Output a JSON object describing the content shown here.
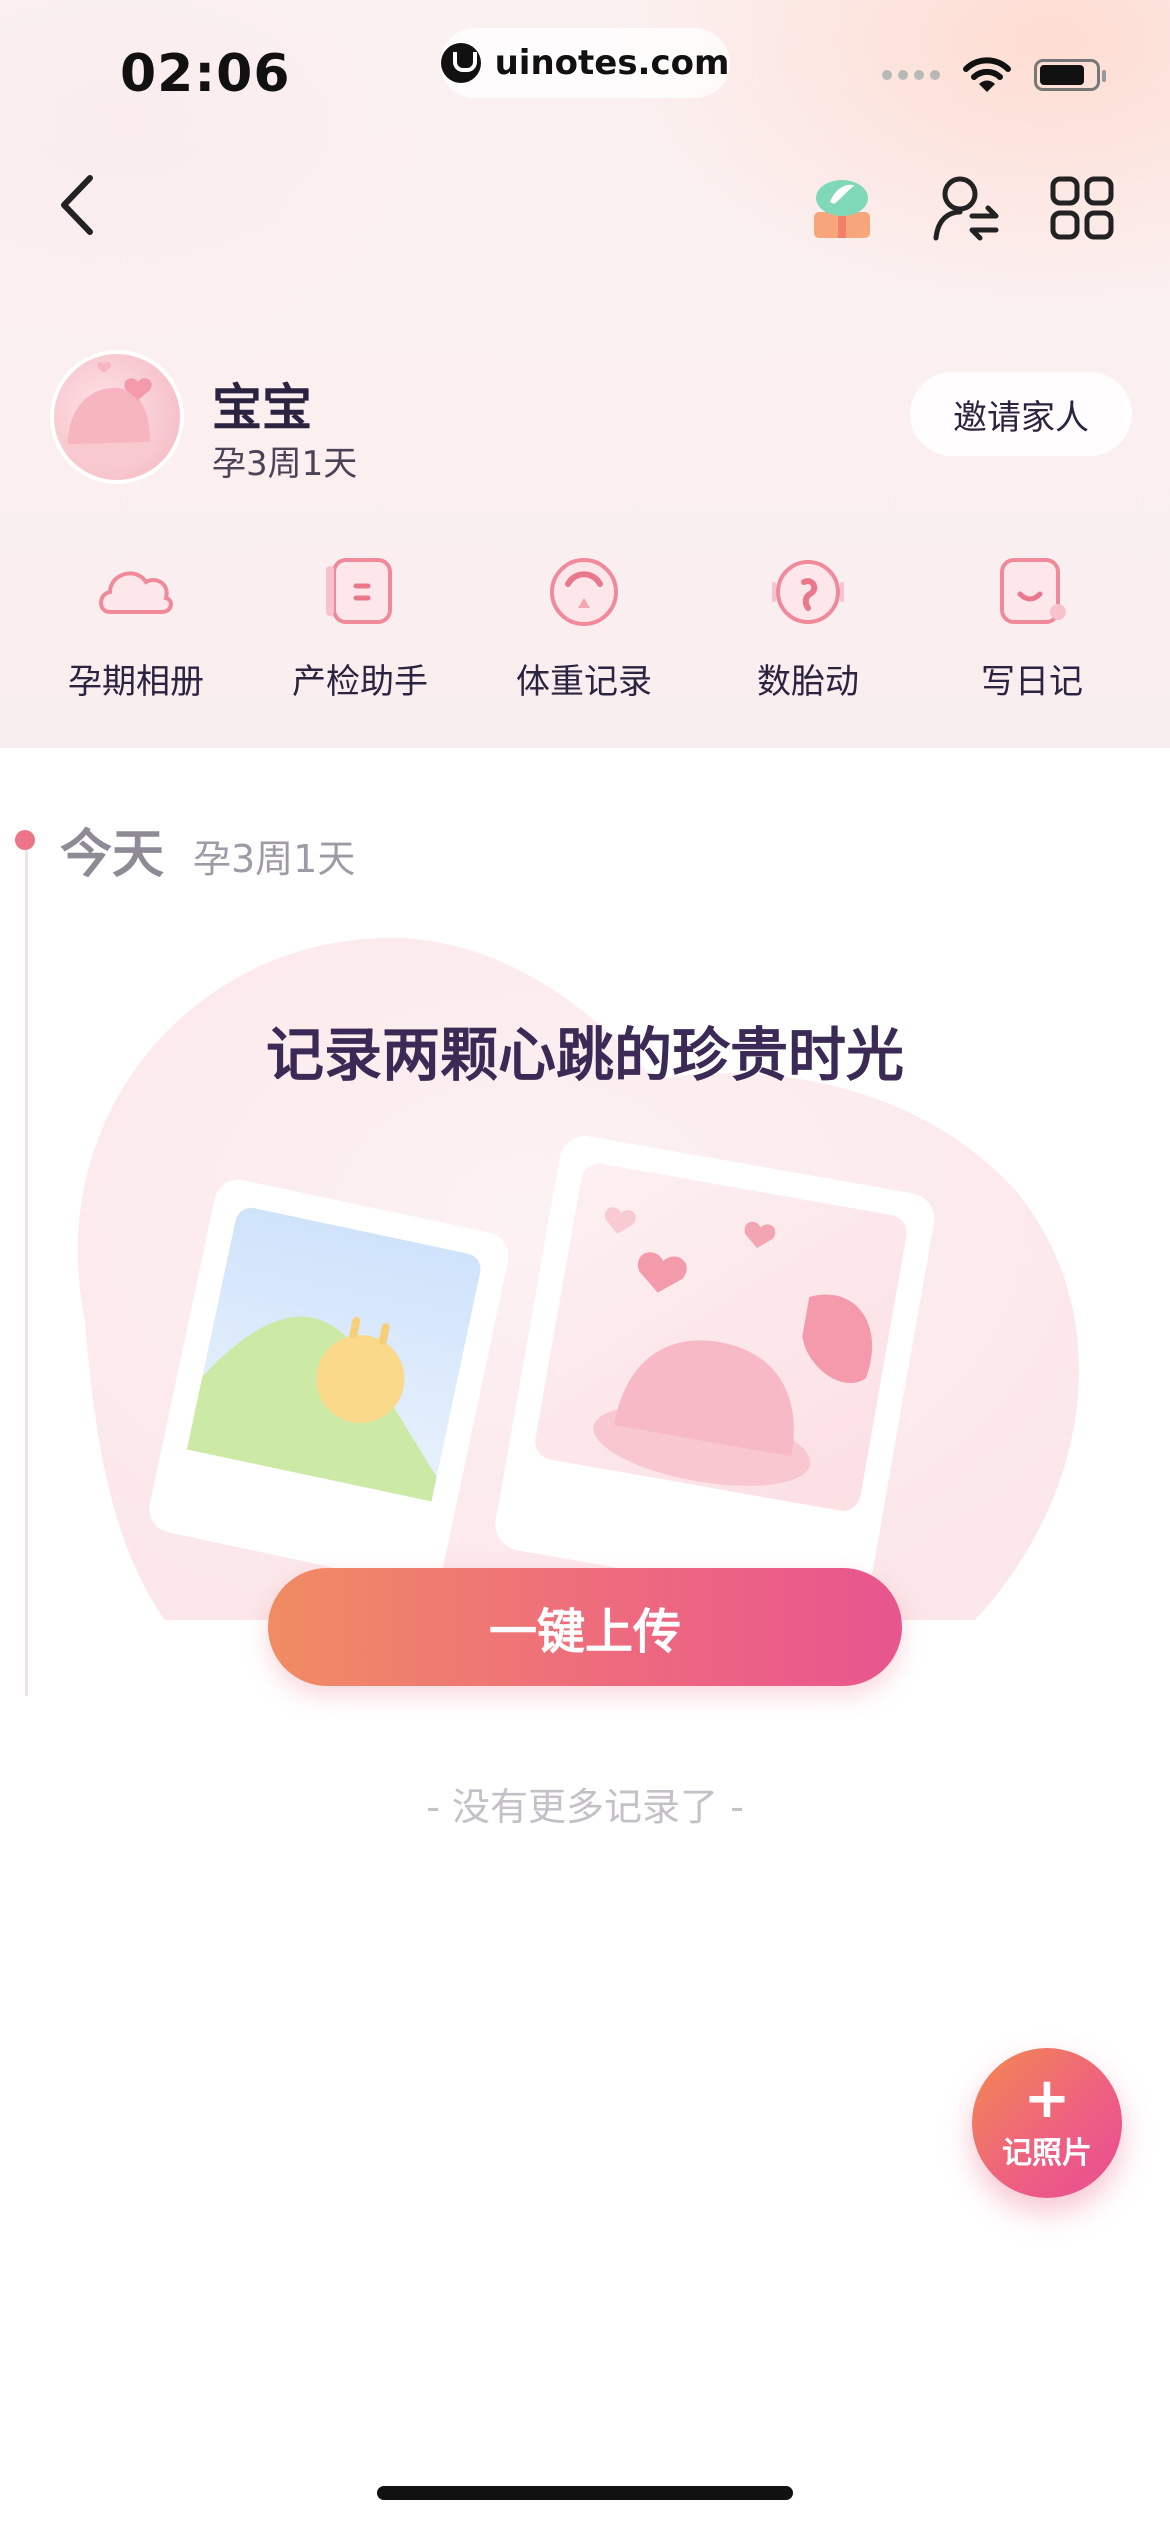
{
  "status_bar": {
    "time": "02:06",
    "url": "uinotes.com"
  },
  "profile": {
    "name": "宝宝",
    "subtitle": "孕3周1天",
    "invite_label": "邀请家人"
  },
  "quick_actions": [
    {
      "label": "孕期相册",
      "icon": "cloud-album-icon"
    },
    {
      "label": "产检助手",
      "icon": "checkup-card-icon"
    },
    {
      "label": "体重记录",
      "icon": "weight-scale-icon"
    },
    {
      "label": "数胎动",
      "icon": "fetal-movement-icon"
    },
    {
      "label": "写日记",
      "icon": "diary-icon"
    }
  ],
  "timeline": {
    "today_label": "今天",
    "today_sub": "孕3周1天"
  },
  "empty_card": {
    "title": "记录两颗心跳的珍贵时光",
    "upload_label": "一键上传"
  },
  "footer_text": "- 没有更多记录了 -",
  "fab": {
    "plus": "+",
    "label": "记照片"
  },
  "colors": {
    "accent_start": "#f08c63",
    "accent_end": "#e8558f",
    "timeline_dot": "#ec7688"
  }
}
